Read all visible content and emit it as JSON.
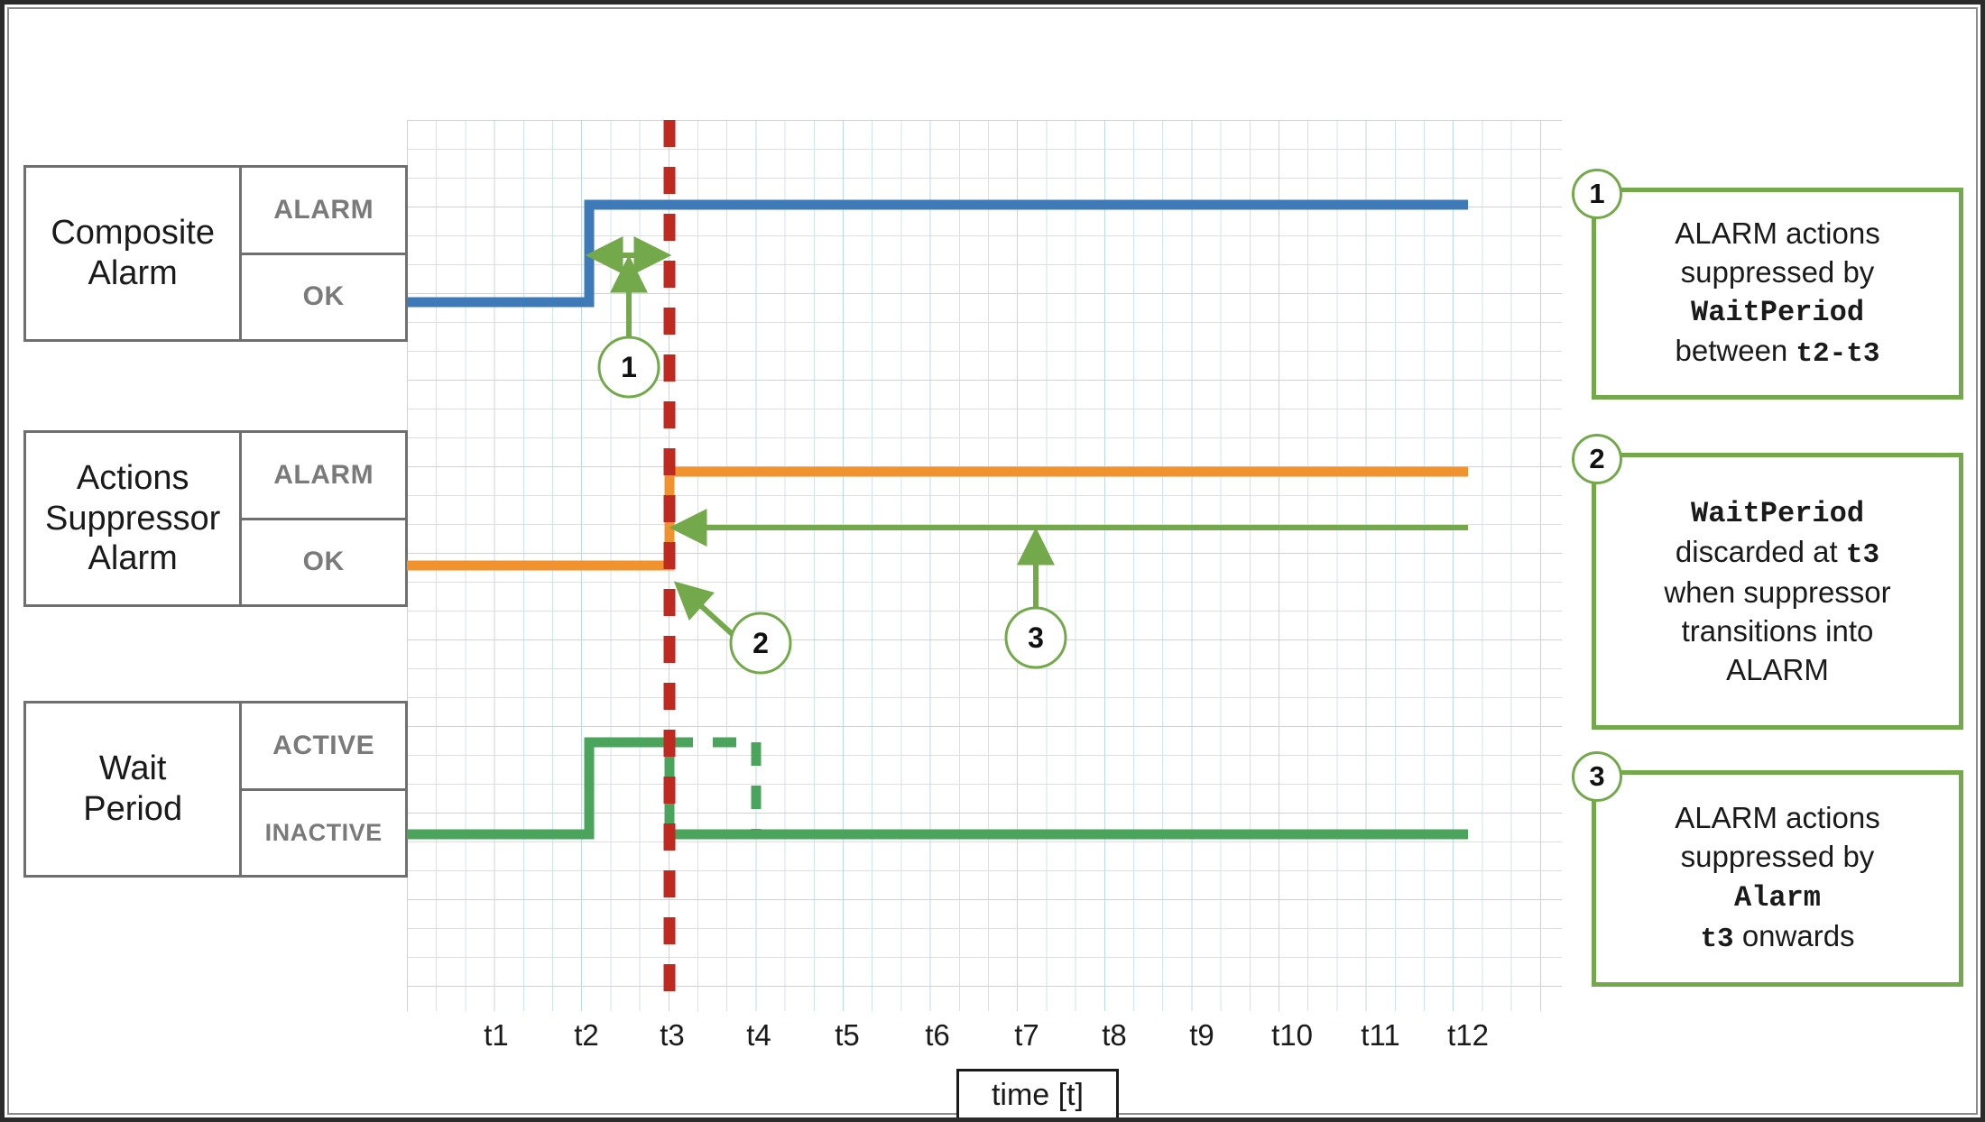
{
  "colors": {
    "composite_alarm_line": "#3f7ab8",
    "suppressor_line": "#f0922e",
    "wait_period_line": "#4aa45c",
    "now_marker": "#bf2a20",
    "annotation": "#74a94b",
    "grid": "#cfe4f2",
    "box_border": "#6f6f6f",
    "state_text": "#7a7a7a"
  },
  "signals": [
    {
      "name": "Composite Alarm",
      "name_line1": "Composite",
      "name_line2": "Alarm",
      "states": {
        "high": "ALARM",
        "low": "OK"
      }
    },
    {
      "name": "Actions Suppressor Alarm",
      "name_line1": "Actions",
      "name_line2": "Suppressor",
      "name_line3": "Alarm",
      "states": {
        "high": "ALARM",
        "low": "OK"
      }
    },
    {
      "name": "Wait Period",
      "name_line1": "Wait",
      "name_line2": "Period",
      "states": {
        "high": "ACTIVE",
        "low": "INACTIVE"
      }
    }
  ],
  "axis": {
    "label": "time [t]",
    "ticks": [
      "t1",
      "t2",
      "t3",
      "t4",
      "t5",
      "t6",
      "t7",
      "t8",
      "t9",
      "t10",
      "t11",
      "t12"
    ]
  },
  "markers": {
    "now_at": "t3"
  },
  "annotations": [
    {
      "id": "1",
      "badge": "1"
    },
    {
      "id": "2",
      "badge": "2"
    },
    {
      "id": "3",
      "badge": "3"
    }
  ],
  "callouts": [
    {
      "badge": "1",
      "line1": "ALARM actions",
      "line2": "suppressed by",
      "line3_mono": "WaitPeriod",
      "line4_pre": "between ",
      "line4_mono": "t2-t3"
    },
    {
      "badge": "2",
      "line1_mono": "WaitPeriod",
      "line2_pre": "discarded at ",
      "line2_mono": "t3",
      "line3": "when suppressor",
      "line4": "transitions into",
      "line5": "ALARM"
    },
    {
      "badge": "3",
      "line1": "ALARM actions",
      "line2": "suppressed by",
      "line3_mono": "Alarm",
      "line4_mono": "t3",
      "line4_post": " onwards"
    }
  ],
  "chart_data": {
    "type": "line",
    "title": "",
    "xlabel": "time [t]",
    "ylabel": "",
    "x": [
      "t1",
      "t2",
      "t3",
      "t4",
      "t5",
      "t6",
      "t7",
      "t8",
      "t9",
      "t10",
      "t11",
      "t12"
    ],
    "grid": true,
    "legend": "left-table",
    "series": [
      {
        "name": "Composite Alarm",
        "color": "#3f7ab8",
        "style": "step",
        "levels": [
          "OK",
          "ALARM"
        ],
        "transitions": [
          {
            "at": "t0",
            "value": "OK"
          },
          {
            "at": "t2",
            "value": "ALARM"
          },
          {
            "at": "t12",
            "value": "ALARM"
          }
        ]
      },
      {
        "name": "Actions Suppressor Alarm",
        "color": "#f0922e",
        "style": "step",
        "levels": [
          "OK",
          "ALARM"
        ],
        "transitions": [
          {
            "at": "t0",
            "value": "OK"
          },
          {
            "at": "t3",
            "value": "ALARM"
          },
          {
            "at": "t12",
            "value": "ALARM"
          }
        ]
      },
      {
        "name": "Wait Period",
        "color": "#4aa45c",
        "style": "step",
        "levels": [
          "INACTIVE",
          "ACTIVE"
        ],
        "transitions": [
          {
            "at": "t0",
            "value": "INACTIVE"
          },
          {
            "at": "t2",
            "value": "ACTIVE"
          },
          {
            "at": "t3",
            "value": "INACTIVE"
          },
          {
            "at": "t12",
            "value": "INACTIVE"
          }
        ],
        "dashed_ghost": {
          "from": "t3",
          "to": "t4",
          "value": "ACTIVE",
          "note": "WaitPeriod would have ended at t4"
        }
      }
    ],
    "vertical_marker": {
      "at": "t3",
      "color": "#bf2a20",
      "style": "dashed"
    }
  }
}
